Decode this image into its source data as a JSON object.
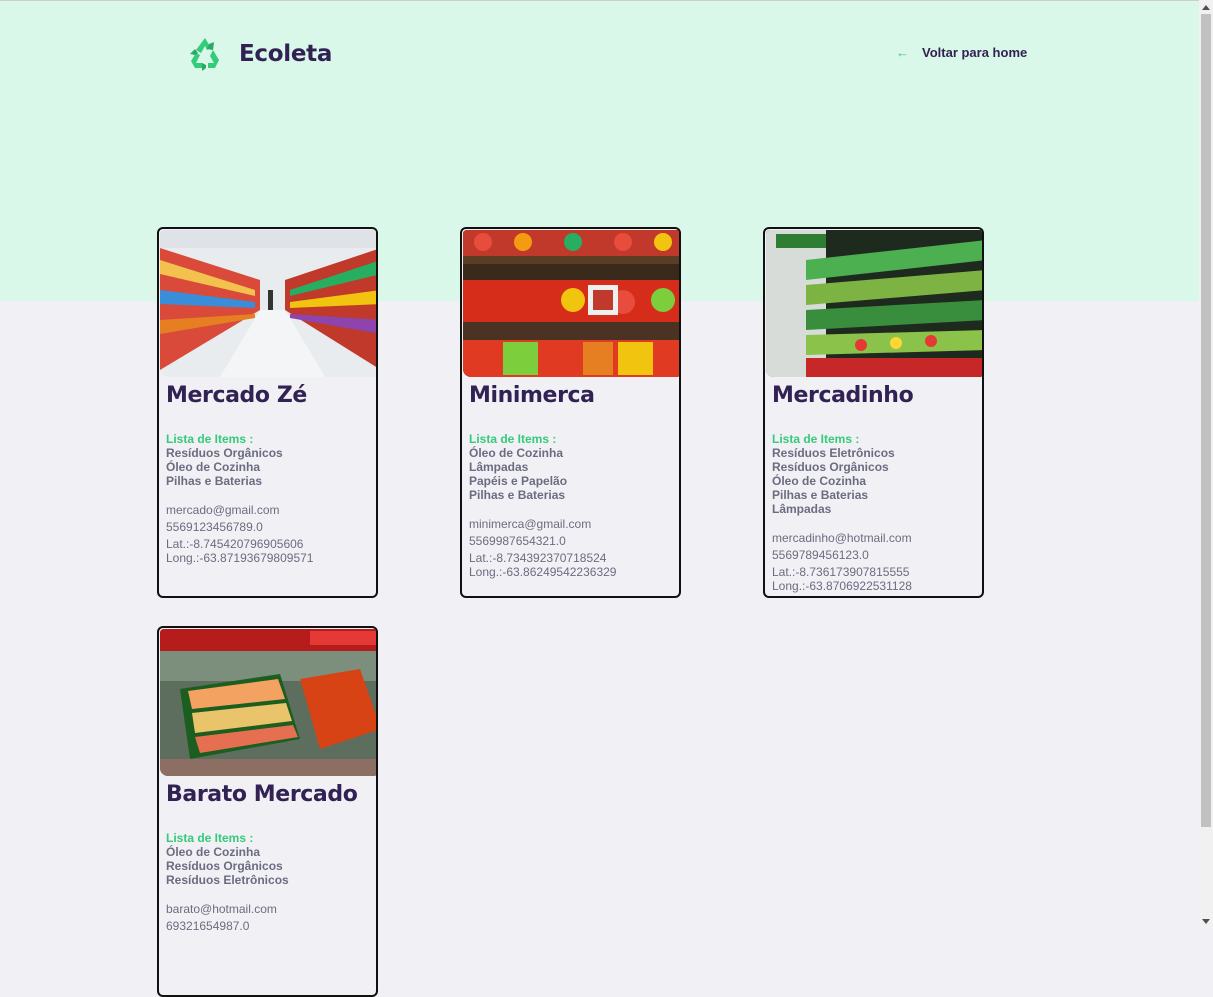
{
  "header": {
    "logo_text": "Ecoleta",
    "logo_icon": "recycle-icon",
    "back_link": "Voltar para home",
    "back_icon": "arrow-left-icon"
  },
  "colors": {
    "brand": "#34cb79",
    "title": "#322153",
    "text": "#6c6c80",
    "hero_bg": "#d9f8ea",
    "page_bg": "#f0f0f5"
  },
  "points": [
    {
      "name": "Mercado Zé",
      "items_label": "Lista de Items :",
      "items": [
        "Resíduos Orgânicos",
        "Óleo de Cozinha",
        "Pilhas e Baterias"
      ],
      "email": "mercado@gmail.com",
      "whatsapp": "5569123456789.0",
      "lat": "Lat.:-8.745420796905606",
      "long": "Long.:-63.87193679809571",
      "image": "supermarket-aisle-photo"
    },
    {
      "name": "Minimerca",
      "items_label": "Lista de Items :",
      "items": [
        "Óleo de Cozinha",
        "Lâmpadas",
        "Papéis e Papelão",
        "Pilhas e Baterias"
      ],
      "email": "minimerca@gmail.com",
      "whatsapp": "55699876543​21.0",
      "lat": "Lat.:-8.734392370718524",
      "long": "Long.:-63.86249542236329",
      "image": "fruit-shelves-photo"
    },
    {
      "name": "Mercadinho",
      "items_label": "Lista de Items :",
      "items": [
        "Resíduos Eletrônicos",
        "Resíduos Orgânicos",
        "Óleo de Cozinha",
        "Pilhas e Baterias",
        "Lâmpadas"
      ],
      "email": "mercadinho@hotmail.com",
      "whatsapp": "5569789456123.0",
      "lat": "Lat.:-8.736173907815555",
      "long": "Long.:-63.8706922531128",
      "image": "vegetable-shelves-photo"
    },
    {
      "name": "Barato Mercado",
      "items_label": "Lista de Items :",
      "items": [
        "Óleo de Cozinha",
        "Resíduos Orgânicos",
        "Resíduos Eletrônicos"
      ],
      "email": "barato@hotmail.com",
      "whatsapp": "69321654987.0",
      "lat": "",
      "long": "",
      "image": "produce-market-photo"
    }
  ]
}
